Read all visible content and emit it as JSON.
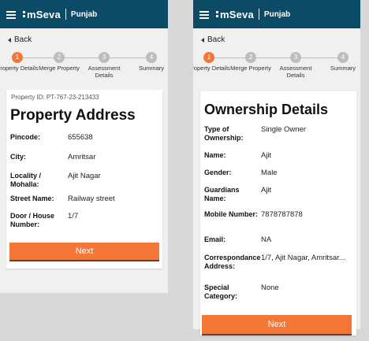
{
  "app": {
    "brand": "mSeva",
    "state": "Punjab"
  },
  "back_label": "Back",
  "steps": [
    {
      "num": "1",
      "label": "Property Details"
    },
    {
      "num": "2",
      "label": "Merge Property"
    },
    {
      "num": "3",
      "label": "Assessment Details"
    },
    {
      "num": "4",
      "label": "Summary"
    }
  ],
  "colors": {
    "appbar": "#0b4b66",
    "accent": "#f47738"
  },
  "screen1": {
    "property_id": "Property ID: PT-767-23-213433",
    "title": "Property Address",
    "fields": [
      {
        "label": "Pincode:",
        "value": "655638"
      },
      {
        "label": "City:",
        "value": "Amritsar"
      },
      {
        "label": "Locality / Mohalla:",
        "value": "Ajit Nagar"
      },
      {
        "label": "Street Name:",
        "value": "Railway street"
      },
      {
        "label": "Door / House Number:",
        "value": "1/7"
      }
    ],
    "next_label": "Next"
  },
  "screen2": {
    "title": "Ownership Details",
    "fields": [
      {
        "label": "Type of Ownership:",
        "value": "Single Owner"
      },
      {
        "label": "Name:",
        "value": "Ajit"
      },
      {
        "label": "Gender:",
        "value": "Male"
      },
      {
        "label": "Guardians Name:",
        "value": "Ajit"
      },
      {
        "label": "Mobile Number:",
        "value": "7878787878"
      },
      {
        "label": "Email:",
        "value": "NA"
      },
      {
        "label": "Correspondance Address:",
        "value": "1/7, Ajit Nagar, Amritsar..."
      },
      {
        "label": "Special Category:",
        "value": "None"
      }
    ],
    "next_label": "Next"
  }
}
